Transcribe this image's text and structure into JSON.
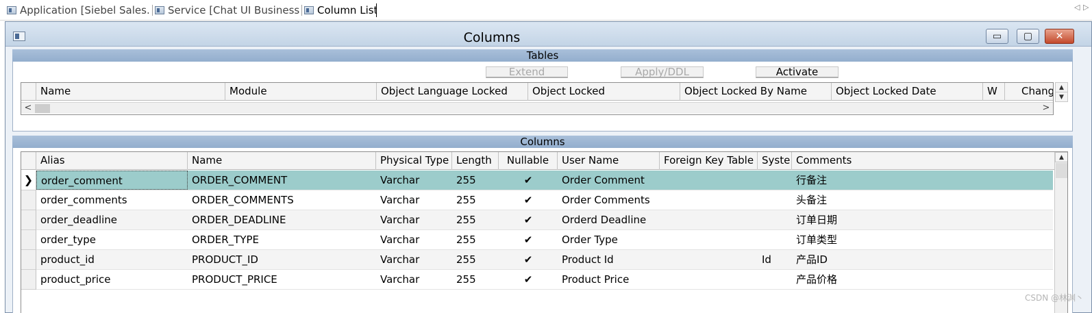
{
  "tabs": [
    {
      "label": "Application [Siebel Sales..."
    },
    {
      "label": "Service [Chat UI Business..."
    },
    {
      "label": "Column List"
    }
  ],
  "tab_nav": {
    "left": "◁",
    "right": "▷"
  },
  "window": {
    "title": "Columns",
    "controls": {
      "minimize": "▭",
      "maximize": "▢",
      "close": "✕"
    }
  },
  "tables_pane": {
    "header": "Tables",
    "buttons": {
      "extend": "Extend",
      "apply_ddl": "Apply/DDL",
      "activate": "Activate"
    },
    "columns": [
      "Name",
      "Module",
      "Object Language Locked",
      "Object Locked",
      "Object Locked By Name",
      "Object Locked Date",
      "W",
      "Chang"
    ],
    "scroll": {
      "left": "<",
      "right": ">",
      "up": "▲",
      "down": "▼"
    }
  },
  "columns_pane": {
    "header": "Columns",
    "columns": [
      "Alias",
      "Name",
      "Physical Type",
      "Length",
      "Nullable",
      "User Name",
      "Foreign Key Table",
      "Syste",
      "Comments"
    ],
    "current_row_marker": "❯",
    "rows": [
      {
        "alias": "order_comment",
        "name": "ORDER_COMMENT",
        "type": "Varchar",
        "length": "255",
        "nullable": "✔",
        "user_name": "Order Comment",
        "fk_table": "",
        "system": "",
        "comments": "行备注"
      },
      {
        "alias": "order_comments",
        "name": "ORDER_COMMENTS",
        "type": "Varchar",
        "length": "255",
        "nullable": "✔",
        "user_name": "Order Comments",
        "fk_table": "",
        "system": "",
        "comments": "头备注"
      },
      {
        "alias": "order_deadline",
        "name": "ORDER_DEADLINE",
        "type": "Varchar",
        "length": "255",
        "nullable": "✔",
        "user_name": "Orderd Deadline",
        "fk_table": "",
        "system": "",
        "comments": "订单日期"
      },
      {
        "alias": "order_type",
        "name": "ORDER_TYPE",
        "type": "Varchar",
        "length": "255",
        "nullable": "✔",
        "user_name": "Order Type",
        "fk_table": "",
        "system": "",
        "comments": "订单类型"
      },
      {
        "alias": "product_id",
        "name": "PRODUCT_ID",
        "type": "Varchar",
        "length": "255",
        "nullable": "✔",
        "user_name": "Product Id",
        "fk_table": "",
        "system": "Id",
        "comments": "产品ID"
      },
      {
        "alias": "product_price",
        "name": "PRODUCT_PRICE",
        "type": "Varchar",
        "length": "255",
        "nullable": "✔",
        "user_name": "Product Price",
        "fk_table": "",
        "system": "",
        "comments": "产品价格"
      }
    ],
    "scroll": {
      "up": "▲"
    }
  },
  "watermark": "CSDN @林渊丶"
}
